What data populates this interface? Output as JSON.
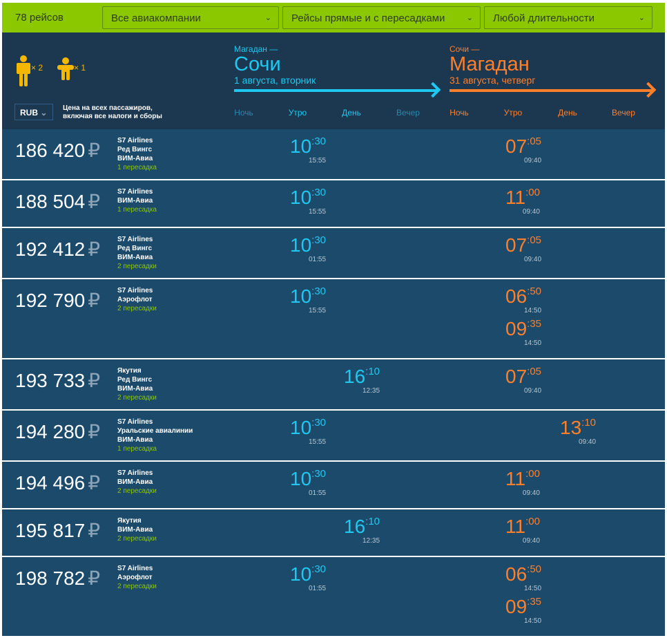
{
  "filters": {
    "count": "78 рейсов",
    "airlines": "Все авиакомпании",
    "stops": "Рейсы прямые и с пересадками",
    "duration": "Любой длительности"
  },
  "passengers": {
    "adults": "× 2",
    "children": "× 1",
    "currency": "RUB",
    "note1": "Цена на всех пассажиров,",
    "note2": "включая все налоги и сборы"
  },
  "outbound": {
    "from": "Магадан —",
    "to": "Сочи",
    "date": "1 августа, вторник",
    "color": "#1fc8f0"
  },
  "return": {
    "from": "Сочи —",
    "to": "Магадан",
    "date": "31 августа, четверг",
    "color": "#ff7f2a"
  },
  "periods": [
    "Ночь",
    "Утро",
    "День",
    "Вечер"
  ],
  "flights": [
    {
      "price": "186 420",
      "airlines": [
        "S7 Airlines",
        "Ред Вингс",
        "ВИМ-Авиа"
      ],
      "stops": "1 пересадка",
      "out": [
        {
          "p": 1,
          "h": "10",
          "m": ":30",
          "d": "15:55"
        }
      ],
      "ret": [
        {
          "p": 1,
          "h": "07",
          "m": ":05",
          "d": "09:40"
        }
      ]
    },
    {
      "price": "188 504",
      "airlines": [
        "S7 Airlines",
        "ВИМ-Авиа"
      ],
      "stops": "1 пересадка",
      "out": [
        {
          "p": 1,
          "h": "10",
          "m": ":30",
          "d": "15:55"
        }
      ],
      "ret": [
        {
          "p": 1,
          "h": "11",
          "m": ":00",
          "d": "09:40"
        }
      ]
    },
    {
      "price": "192 412",
      "airlines": [
        "S7 Airlines",
        "Ред Вингс",
        "ВИМ-Авиа"
      ],
      "stops": "2 пересадки",
      "out": [
        {
          "p": 1,
          "h": "10",
          "m": ":30",
          "d": "01:55"
        }
      ],
      "ret": [
        {
          "p": 1,
          "h": "07",
          "m": ":05",
          "d": "09:40"
        }
      ]
    },
    {
      "price": "192 790",
      "airlines": [
        "S7 Airlines",
        "Аэрофлот"
      ],
      "stops": "2 пересадки",
      "out": [
        {
          "p": 1,
          "h": "10",
          "m": ":30",
          "d": "15:55"
        }
      ],
      "ret": [
        {
          "p": 1,
          "h": "06",
          "m": ":50",
          "d": "14:50"
        },
        {
          "p": 1,
          "h": "09",
          "m": ":35",
          "d": "14:50"
        }
      ]
    },
    {
      "price": "193 733",
      "airlines": [
        "Якутия",
        "Ред Вингс",
        "ВИМ-Авиа"
      ],
      "stops": "2 пересадки",
      "out": [
        {
          "p": 2,
          "h": "16",
          "m": ":10",
          "d": "12:35"
        }
      ],
      "ret": [
        {
          "p": 1,
          "h": "07",
          "m": ":05",
          "d": "09:40"
        }
      ]
    },
    {
      "price": "194 280",
      "airlines": [
        "S7 Airlines",
        "Уральские авиалинии",
        "ВИМ-Авиа"
      ],
      "stops": "1 пересадка",
      "out": [
        {
          "p": 1,
          "h": "10",
          "m": ":30",
          "d": "15:55"
        }
      ],
      "ret": [
        {
          "p": 2,
          "h": "13",
          "m": ":10",
          "d": "09:40"
        }
      ]
    },
    {
      "price": "194 496",
      "airlines": [
        "S7 Airlines",
        "ВИМ-Авиа"
      ],
      "stops": "2 пересадки",
      "out": [
        {
          "p": 1,
          "h": "10",
          "m": ":30",
          "d": "01:55"
        }
      ],
      "ret": [
        {
          "p": 1,
          "h": "11",
          "m": ":00",
          "d": "09:40"
        }
      ]
    },
    {
      "price": "195 817",
      "airlines": [
        "Якутия",
        "ВИМ-Авиа"
      ],
      "stops": "2 пересадки",
      "out": [
        {
          "p": 2,
          "h": "16",
          "m": ":10",
          "d": "12:35"
        }
      ],
      "ret": [
        {
          "p": 1,
          "h": "11",
          "m": ":00",
          "d": "09:40"
        }
      ]
    },
    {
      "price": "198 782",
      "airlines": [
        "S7 Airlines",
        "Аэрофлот"
      ],
      "stops": "2 пересадки",
      "out": [
        {
          "p": 1,
          "h": "10",
          "m": ":30",
          "d": "01:55"
        }
      ],
      "ret": [
        {
          "p": 1,
          "h": "06",
          "m": ":50",
          "d": "14:50"
        },
        {
          "p": 1,
          "h": "09",
          "m": ":35",
          "d": "14:50"
        }
      ]
    }
  ],
  "currency_symbol": "₽"
}
